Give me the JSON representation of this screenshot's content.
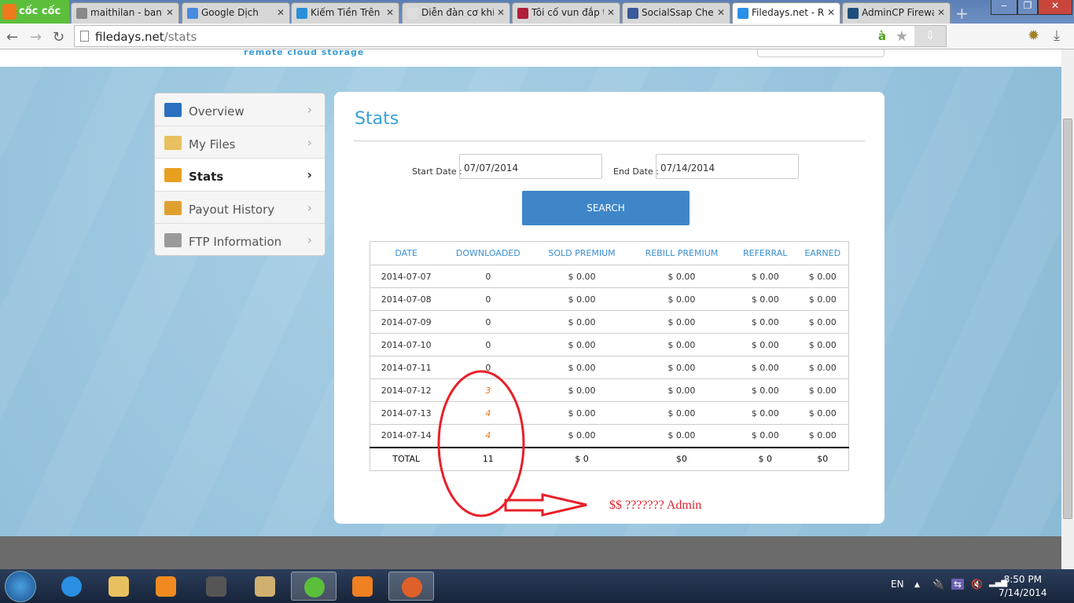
{
  "browser": {
    "brand": "cốc cốc",
    "tabs": [
      {
        "label": "maithilan - bank",
        "color": "#888"
      },
      {
        "label": "Google Dịch",
        "color": "#4a8be0"
      },
      {
        "label": "Kiếm Tiền Trên I",
        "color": "#2a8fd8"
      },
      {
        "label": "Diễn đàn cơ khí,",
        "color": "#ddd"
      },
      {
        "label": "Tôi cố vun đắp t",
        "color": "#b0203a"
      },
      {
        "label": "SocialSsap Chea",
        "color": "#3b5998"
      },
      {
        "label": "Filedays.net - Re",
        "color": "#2a8fe8"
      },
      {
        "label": "AdminCP Firewa",
        "color": "#1e4f7a"
      }
    ],
    "active_tab": 6,
    "url_host": "filedays.net",
    "url_path": "/stats"
  },
  "site": {
    "tagline": "remote cloud storage"
  },
  "sidebar": {
    "items": [
      {
        "label": "Overview",
        "icon": "monitor-icon",
        "color": "#2a6fc0"
      },
      {
        "label": "My Files",
        "icon": "folder-icon",
        "color": "#e8c060"
      },
      {
        "label": "Stats",
        "icon": "bar-chart-icon",
        "color": "#e9a020"
      },
      {
        "label": "Payout History",
        "icon": "coins-icon",
        "color": "#e0a030"
      },
      {
        "label": "FTP Information",
        "icon": "server-icon",
        "color": "#9a9a9a"
      }
    ],
    "active": 2
  },
  "main": {
    "title": "Stats",
    "start_label": "Start Date :",
    "start_value": "07/07/2014",
    "end_label": "End Date :",
    "end_value": "07/14/2014",
    "search_label": "SEARCH",
    "columns": [
      "DATE",
      "DOWNLOADED",
      "SOLD PREMIUM",
      "REBILL PREMIUM",
      "REFERRAL",
      "EARNED"
    ],
    "rows": [
      [
        "2014-07-07",
        "0",
        "$ 0.00",
        "$ 0.00",
        "$ 0.00",
        "$ 0.00"
      ],
      [
        "2014-07-08",
        "0",
        "$ 0.00",
        "$ 0.00",
        "$ 0.00",
        "$ 0.00"
      ],
      [
        "2014-07-09",
        "0",
        "$ 0.00",
        "$ 0.00",
        "$ 0.00",
        "$ 0.00"
      ],
      [
        "2014-07-10",
        "0",
        "$ 0.00",
        "$ 0.00",
        "$ 0.00",
        "$ 0.00"
      ],
      [
        "2014-07-11",
        "0",
        "$ 0.00",
        "$ 0.00",
        "$ 0.00",
        "$ 0.00"
      ],
      [
        "2014-07-12",
        "3",
        "$ 0.00",
        "$ 0.00",
        "$ 0.00",
        "$ 0.00"
      ],
      [
        "2014-07-13",
        "4",
        "$ 0.00",
        "$ 0.00",
        "$ 0.00",
        "$ 0.00"
      ],
      [
        "2014-07-14",
        "4",
        "$ 0.00",
        "$ 0.00",
        "$ 0.00",
        "$ 0.00"
      ]
    ],
    "total": [
      "TOTAL",
      "11",
      "$ 0",
      "$0",
      "$ 0",
      "$0"
    ]
  },
  "annotation": {
    "text": "$$ ??????? Admin",
    "color": "#e0202a"
  },
  "taskbar": {
    "lang": "EN",
    "time": "8:50 PM",
    "date": "7/14/2014"
  }
}
